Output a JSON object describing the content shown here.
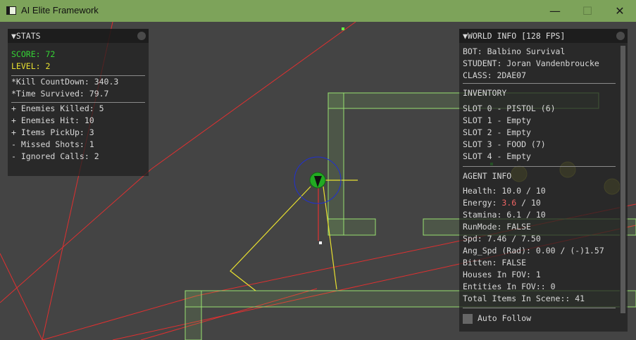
{
  "window": {
    "title": "AI Elite Framework",
    "icon": "app-window-icon",
    "controls": {
      "minimize": "—",
      "maximize": "☐",
      "close": "✕"
    }
  },
  "colors": {
    "titlebar": "#7da35a",
    "background": "#444444",
    "walls": "#98e070",
    "paths": "#e03030",
    "fov": "#e8e030",
    "agent": "#22aa22",
    "agent_ring": "#2030d0",
    "items": "#a0a040"
  },
  "stats": {
    "header": "▼STATS",
    "score": "SCORE: 72",
    "level": "LEVEL: 2",
    "kill_countdown": "*Kill CountDown: 340.3",
    "time_survived": "*Time Survived: 79.7",
    "enemies_killed": "+ Enemies Killed: 5",
    "enemies_hit": "+ Enemies Hit: 10",
    "items_pickup": "+ Items PickUp: 3",
    "missed_shots": "- Missed Shots: 1",
    "ignored_calls": "- Ignored Calls: 2"
  },
  "world_info": {
    "header": "▼WORLD INFO [128 FPS]",
    "bot": "BOT: Balbino Survival",
    "student": "STUDENT: Joran Vandenbroucke",
    "class": "CLASS: 2DAE07",
    "inventory_title": "INVENTORY",
    "slots": [
      "SLOT 0 - PISTOL (6)",
      "SLOT 1 - Empty",
      "SLOT 2 - Empty",
      "SLOT 3 - FOOD (7)",
      "SLOT 4 - Empty"
    ],
    "agent_info_title": "AGENT INFO",
    "health": "Health: 10.0 / 10",
    "energy_label": "Energy: ",
    "energy_value": "3.6",
    "energy_max": " / 10",
    "stamina": "Stamina: 6.1 / 10",
    "run_mode": "RunMode: FALSE",
    "speed": "Spd: 7.46 / 7.50",
    "angular_speed": "Ang_Spd (Rad): 0.00 / (-)1.57",
    "bitten": "Bitten: FALSE",
    "houses_in_fov": "Houses In FOV: 1",
    "entities_in_fov": "Entities In FOV:: 0",
    "total_items": "Total Items In Scene:: 41",
    "auto_follow_label": "Auto Follow",
    "auto_follow_checked": false
  }
}
